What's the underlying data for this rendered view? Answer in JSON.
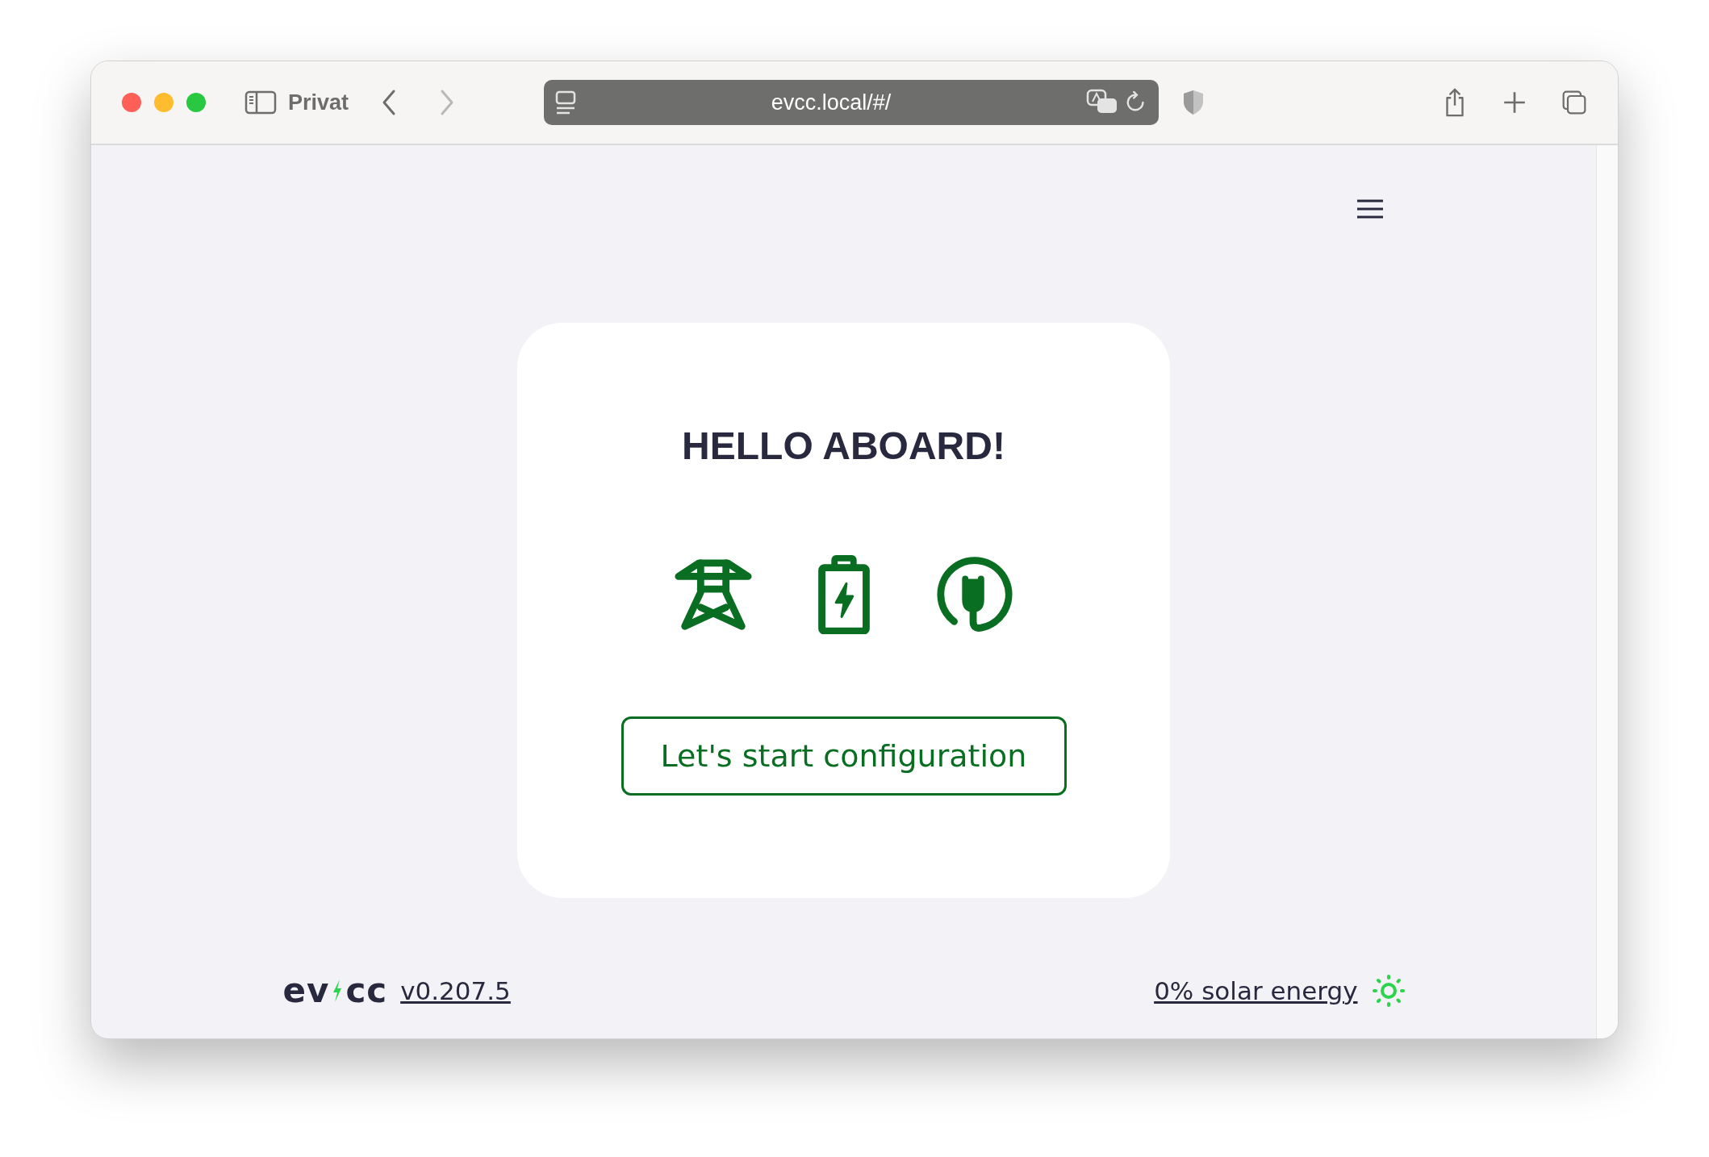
{
  "browser": {
    "profile": "Privat",
    "url": "evcc.local/#/"
  },
  "card": {
    "title": "HELLO ABOARD!",
    "button": "Let's start configuration"
  },
  "footer": {
    "logo_left": "ev",
    "logo_right": "cc",
    "version": "v0.207.5",
    "solar": "0% solar energy"
  }
}
